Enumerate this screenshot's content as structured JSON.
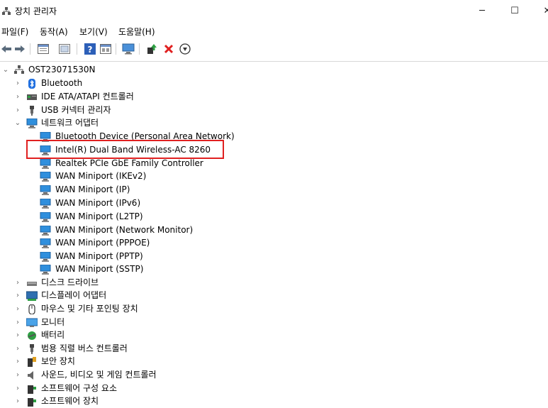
{
  "window": {
    "title": "장치 관리자",
    "minimize_glyph": "─",
    "maximize_glyph": "☐",
    "close_glyph": "✕"
  },
  "menu": [
    {
      "label": "파일(F)"
    },
    {
      "label": "동작(A)"
    },
    {
      "label": "보기(V)"
    },
    {
      "label": "도움말(H)"
    }
  ],
  "toolbar": {
    "icons": [
      "back-arrow-icon",
      "forward-arrow-icon",
      "properties-icon",
      "device-list-icon",
      "help-icon",
      "view-icon",
      "monitor-scan-icon",
      "update-driver-icon",
      "uninstall-icon",
      "disable-device-icon"
    ]
  },
  "tree": {
    "root": {
      "label": "OST23071530N",
      "icon": "computer-icon",
      "expanded": true
    },
    "categories": [
      {
        "label": "Bluetooth",
        "icon": "bluetooth-icon",
        "expanded": false
      },
      {
        "label": "IDE ATA/ATAPI 컨트롤러",
        "icon": "ide-controller-icon",
        "expanded": false
      },
      {
        "label": "USB 커넥터 관리자",
        "icon": "usb-icon",
        "expanded": false
      },
      {
        "label": "네트워크 어댑터",
        "icon": "network-adapter-icon",
        "expanded": true,
        "children": [
          {
            "label": "Bluetooth Device (Personal Area Network)"
          },
          {
            "label": "Intel(R) Dual Band Wireless-AC 8260",
            "highlighted": true
          },
          {
            "label": "Realtek PCIe GbE Family Controller"
          },
          {
            "label": "WAN Miniport (IKEv2)"
          },
          {
            "label": "WAN Miniport (IP)"
          },
          {
            "label": "WAN Miniport (IPv6)"
          },
          {
            "label": "WAN Miniport (L2TP)"
          },
          {
            "label": "WAN Miniport (Network Monitor)"
          },
          {
            "label": "WAN Miniport (PPPOE)"
          },
          {
            "label": "WAN Miniport (PPTP)"
          },
          {
            "label": "WAN Miniport (SSTP)"
          }
        ]
      },
      {
        "label": "디스크 드라이브",
        "icon": "disk-drive-icon",
        "expanded": false
      },
      {
        "label": "디스플레이 어댑터",
        "icon": "display-adapter-icon",
        "expanded": false
      },
      {
        "label": "마우스 및 기타 포인팅 장치",
        "icon": "mouse-icon",
        "expanded": false
      },
      {
        "label": "모니터",
        "icon": "monitor-icon",
        "expanded": false
      },
      {
        "label": "배터리",
        "icon": "battery-icon",
        "expanded": false
      },
      {
        "label": "범용 직렬 버스 컨트롤러",
        "icon": "usb-controller-icon",
        "expanded": false
      },
      {
        "label": "보안 장치",
        "icon": "security-device-icon",
        "expanded": false
      },
      {
        "label": "사운드, 비디오 및 게임 컨트롤러",
        "icon": "speaker-icon",
        "expanded": false
      },
      {
        "label": "소프트웨어 구성 요소",
        "icon": "software-component-icon",
        "expanded": false
      },
      {
        "label": "소프트웨어 장치",
        "icon": "software-device-icon",
        "expanded": false
      }
    ]
  },
  "colors": {
    "highlight_border": "#e02020",
    "network_icon": "#2f8fdd"
  }
}
